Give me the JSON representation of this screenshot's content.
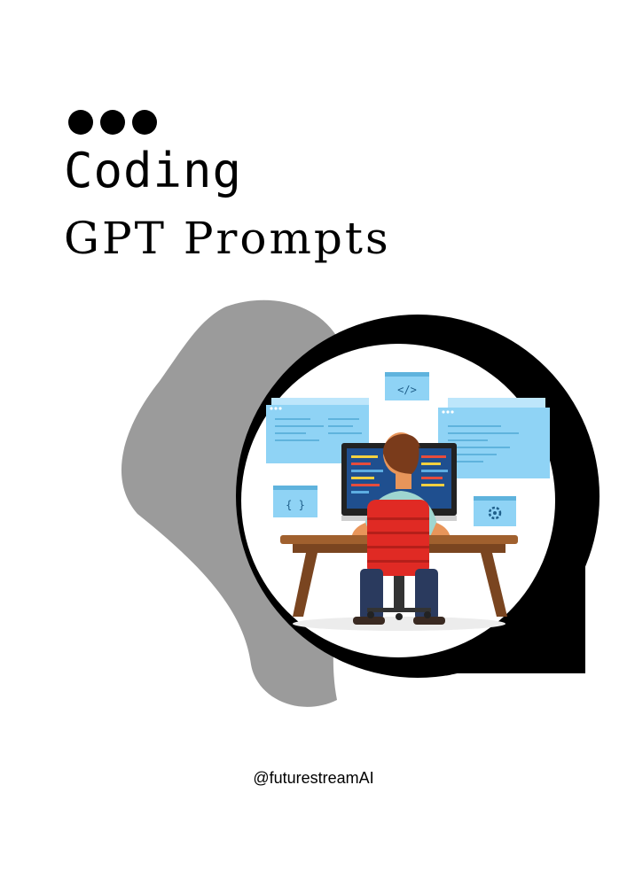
{
  "cover": {
    "title_line1": "Coding",
    "title_line2": "GPT Prompts",
    "handle": "@futurestreamAI"
  },
  "illustration": {
    "code_icon": "</>",
    "braces_icon": "{ }"
  },
  "colors": {
    "blob_gray": "#9b9b9b",
    "frame_black": "#000000",
    "window_blue": "#8fd3f5",
    "chair_red": "#e02a24",
    "desk_brown": "#a0602e"
  }
}
